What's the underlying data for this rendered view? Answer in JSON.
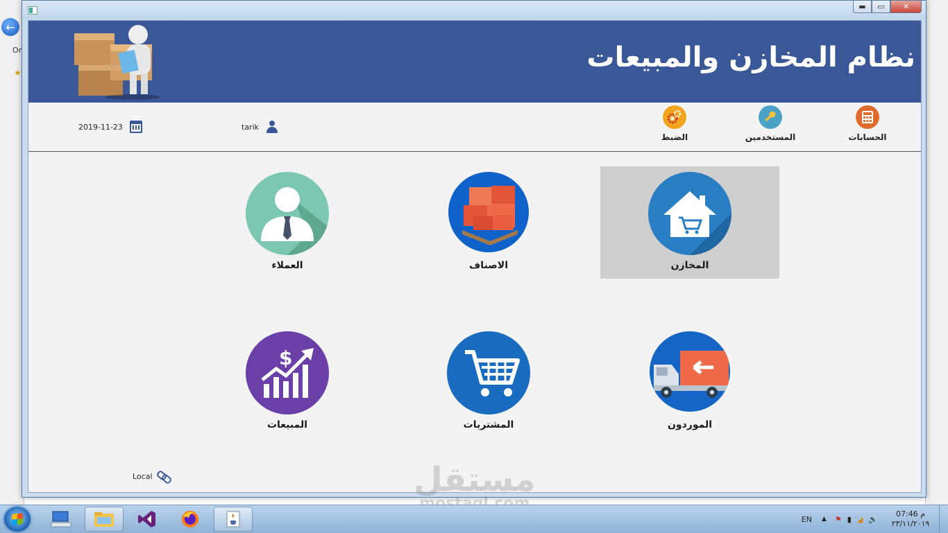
{
  "window": {
    "title_icon": "app-icon",
    "controls": {
      "minimize": "▬",
      "maximize": "▭",
      "close": "✕"
    }
  },
  "header": {
    "title": "نظام المخازن والمبيعات"
  },
  "toolbar": {
    "items": [
      {
        "label": "الحسابات",
        "icon": "calculator-icon",
        "color": "#e06a2c"
      },
      {
        "label": "المستخدمين",
        "icon": "key-icon",
        "color": "#4aa3c7"
      },
      {
        "label": "الضبط",
        "icon": "gears-icon",
        "color": "#f2a51c"
      }
    ],
    "user": "tarik",
    "date": "2019-11-23"
  },
  "tiles": [
    {
      "label": "المخازن",
      "icon": "warehouse-cart-icon",
      "color": "#2a7ec4"
    },
    {
      "label": "الاصناف",
      "icon": "boxes-icon",
      "color": "#0f62c9"
    },
    {
      "label": "العملاء",
      "icon": "customer-icon",
      "color": "#7cc7b0"
    },
    {
      "label": "الموردون",
      "icon": "truck-icon",
      "color": "#1565c7"
    },
    {
      "label": "المشتريات",
      "icon": "cart-icon",
      "color": "#1a6cc0"
    },
    {
      "label": "المبيعات",
      "icon": "sales-chart-icon",
      "color": "#6a3fa8"
    }
  ],
  "status": {
    "connection": "Local"
  },
  "watermark": {
    "line1": "مستقل",
    "line2": "mostaql.com"
  },
  "taskbar": {
    "language": "EN",
    "time": "07:46 م",
    "date": "٢٣/١١/٢٠١٩"
  },
  "background": {
    "text_fragment": "Or"
  }
}
